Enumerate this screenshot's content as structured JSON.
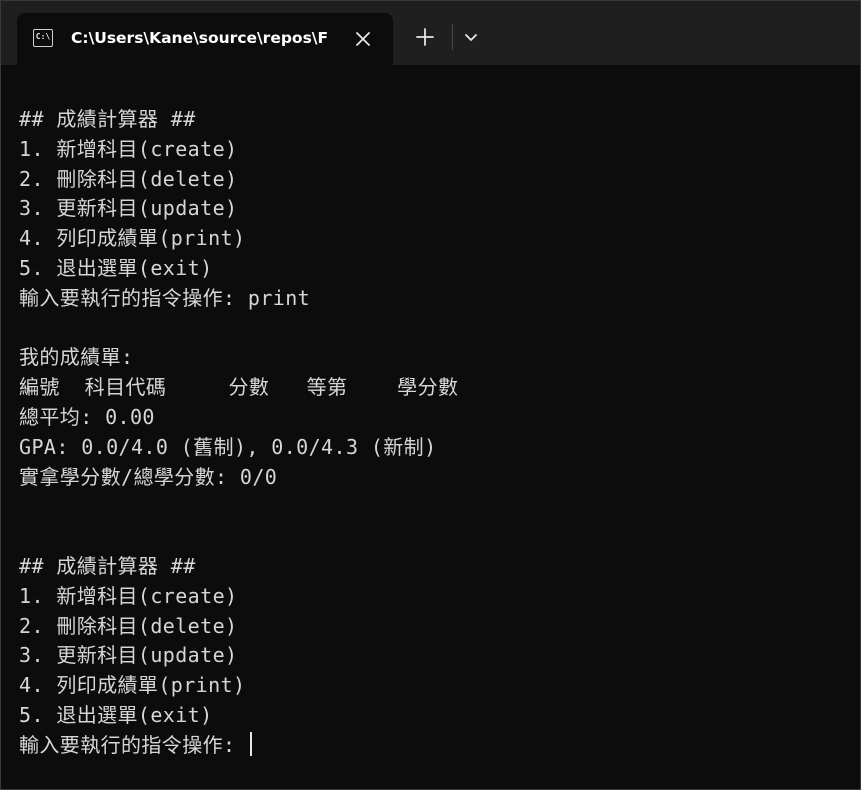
{
  "window": {
    "tab_title": "C:\\Users\\Kane\\source\\repos\\F",
    "tab_icon_text": "C:\\",
    "icons": {
      "terminal": "terminal-icon",
      "close": "close-icon",
      "new_tab": "plus-icon",
      "dropdown": "chevron-down-icon"
    }
  },
  "terminal": {
    "lines": [
      "## 成績計算器 ##",
      "1. 新增科目(create)",
      "2. 刪除科目(delete)",
      "3. 更新科目(update)",
      "4. 列印成績單(print)",
      "5. 退出選單(exit)",
      "輸入要執行的指令操作: print",
      "",
      "我的成績單:",
      "編號  科目代碼     分數   等第    學分數",
      "總平均: 0.00",
      "GPA: 0.0/4.0 (舊制), 0.0/4.3 (新制)",
      "實拿學分數/總學分數: 0/0",
      "",
      "",
      "## 成績計算器 ##",
      "1. 新增科目(create)",
      "2. 刪除科目(delete)",
      "3. 更新科目(update)",
      "4. 列印成績單(print)",
      "5. 退出選單(exit)",
      "輸入要執行的指令操作: "
    ]
  }
}
